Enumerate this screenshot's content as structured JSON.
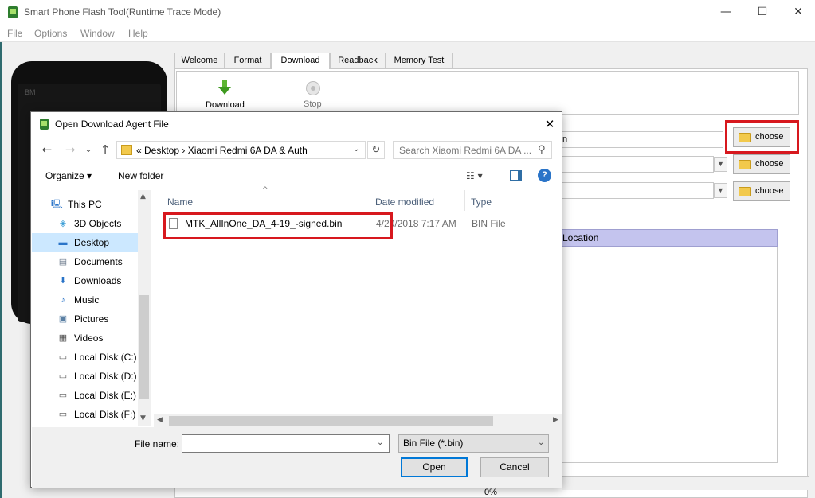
{
  "app": {
    "title": "Smart Phone Flash Tool(Runtime Trace Mode)",
    "window_controls": {
      "minimize": "—",
      "maximize": "☐",
      "close": "✕"
    }
  },
  "menu": [
    "File",
    "Options",
    "Window",
    "Help"
  ],
  "phone": {
    "brand": "BM"
  },
  "tabs": [
    {
      "label": "Welcome",
      "active": false
    },
    {
      "label": "Format",
      "active": false
    },
    {
      "label": "Download",
      "active": true
    },
    {
      "label": "Readback",
      "active": false
    },
    {
      "label": "Memory Test",
      "active": false
    }
  ],
  "toolbar": {
    "download_label": "Download",
    "stop_label": "Stop"
  },
  "fields": [
    {
      "value": "n",
      "choose_label": "choose",
      "highlighted": true
    },
    {
      "value": "",
      "choose_label": "choose",
      "highlighted": false
    },
    {
      "value": "",
      "choose_label": "choose",
      "highlighted": false
    }
  ],
  "table": {
    "header": "Location"
  },
  "progress": {
    "text": "0%"
  },
  "dialog": {
    "title": "Open Download Agent File",
    "close": "✕",
    "nav": {
      "back": "←",
      "forward": "→",
      "recent": "⌄",
      "up": "↑"
    },
    "address": "« Desktop  ›  Xiaomi Redmi 6A DA & Auth",
    "refresh": "↻",
    "search_placeholder": "Search Xiaomi Redmi 6A DA ...",
    "organize_label": "Organize ▾",
    "new_folder_label": "New folder",
    "help": "?",
    "nav_items": [
      {
        "label": "This PC",
        "icon": "this-pc-icon",
        "glyph": "🖳",
        "selected": false
      },
      {
        "label": "3D Objects",
        "icon": "3d-objects-icon",
        "glyph": "◈",
        "selected": false
      },
      {
        "label": "Desktop",
        "icon": "desktop-icon",
        "glyph": "▬",
        "selected": true
      },
      {
        "label": "Documents",
        "icon": "documents-icon",
        "glyph": "▤",
        "selected": false
      },
      {
        "label": "Downloads",
        "icon": "downloads-icon",
        "glyph": "⬇",
        "selected": false
      },
      {
        "label": "Music",
        "icon": "music-icon",
        "glyph": "♪",
        "selected": false
      },
      {
        "label": "Pictures",
        "icon": "pictures-icon",
        "glyph": "▣",
        "selected": false
      },
      {
        "label": "Videos",
        "icon": "videos-icon",
        "glyph": "▦",
        "selected": false
      },
      {
        "label": "Local Disk (C:)",
        "icon": "drive-icon",
        "glyph": "▭",
        "selected": false
      },
      {
        "label": "Local Disk (D:)",
        "icon": "drive-icon",
        "glyph": "▭",
        "selected": false
      },
      {
        "label": "Local Disk (E:)",
        "icon": "drive-icon",
        "glyph": "▭",
        "selected": false
      },
      {
        "label": "Local Disk (F:)",
        "icon": "drive-icon",
        "glyph": "▭",
        "selected": false
      }
    ],
    "columns": {
      "name": "Name",
      "date": "Date modified",
      "type": "Type"
    },
    "files": [
      {
        "name": "MTK_AllInOne_DA_4-19_-signed.bin",
        "date": "4/20/2018 7:17 AM",
        "type": "BIN File"
      }
    ],
    "file_name_label": "File name:",
    "file_name_value": "",
    "filter": "Bin File (*.bin)",
    "open_label": "Open",
    "cancel_label": "Cancel"
  },
  "colors": {
    "highlight": "#d7181e",
    "selection": "#cce8ff",
    "table_header": "#c4c4ee",
    "accent": "#0078d7"
  }
}
